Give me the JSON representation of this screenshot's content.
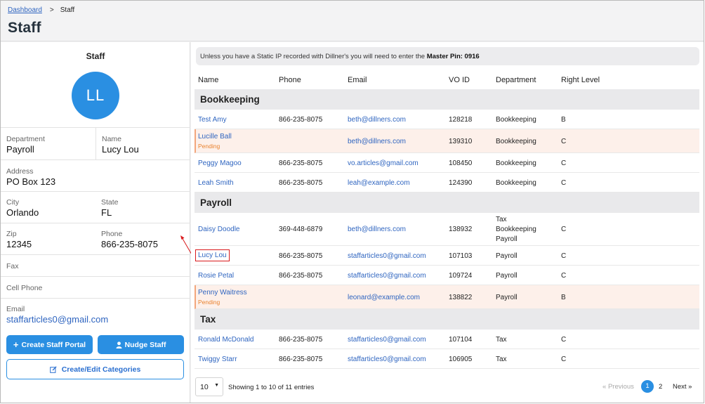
{
  "breadcrumb": {
    "link": "Dashboard",
    "separator": ">",
    "current": "Staff"
  },
  "page_title": "Staff",
  "profile": {
    "title": "Staff",
    "initials": "LL",
    "fields": {
      "department_label": "Department",
      "department": "Payroll",
      "name_label": "Name",
      "name": "Lucy Lou",
      "address_label": "Address",
      "address": "PO Box 123",
      "city_label": "City",
      "city": "Orlando",
      "state_label": "State",
      "state": "FL",
      "zip_label": "Zip",
      "zip": "12345",
      "phone_label": "Phone",
      "phone": "866-235-8075",
      "fax_label": "Fax",
      "cell_label": "Cell Phone",
      "email_label": "Email",
      "email": "staffarticles0@gmail.com"
    },
    "buttons": {
      "create_portal": "Create Staff Portal",
      "nudge": "Nudge Staff",
      "categories": "Create/Edit Categories"
    }
  },
  "notice": {
    "text": "Unless you have a Static IP recorded with Dillner's you will need to enter the ",
    "bold": "Master Pin: 0916"
  },
  "table": {
    "headers": [
      "Name",
      "Phone",
      "Email",
      "VO ID",
      "Department",
      "Right Level"
    ],
    "groups": {
      "bookkeeping": "Bookkeeping",
      "payroll": "Payroll",
      "tax": "Tax"
    },
    "rows": [
      {
        "name": "Test Amy",
        "phone": "866-235-8075",
        "email": "beth@dillners.com",
        "vo_id": "128218",
        "department": "Bookkeeping",
        "level": "B"
      },
      {
        "name": "Lucille Ball",
        "status": "Pending",
        "phone": "",
        "email": "beth@dillners.com",
        "vo_id": "139310",
        "department": "Bookkeeping",
        "level": "C"
      },
      {
        "name": "Peggy Magoo",
        "phone": "866-235-8075",
        "email": "vo.articles@gmail.com",
        "vo_id": "108450",
        "department": "Bookkeeping",
        "level": "C"
      },
      {
        "name": "Leah Smith",
        "phone": "866-235-8075",
        "email": "leah@example.com",
        "vo_id": "124390",
        "department": "Bookkeeping",
        "level": "C"
      },
      {
        "name": "Daisy Doodle",
        "phone": "369-448-6879",
        "email": "beth@dillners.com",
        "vo_id": "138932",
        "department_lines": [
          "Tax",
          "Bookkeeping",
          "Payroll"
        ],
        "level": "C"
      },
      {
        "name": "Lucy Lou",
        "phone": "866-235-8075",
        "email": "staffarticles0@gmail.com",
        "vo_id": "107103",
        "department": "Payroll",
        "level": "C"
      },
      {
        "name": "Rosie Petal",
        "phone": "866-235-8075",
        "email": "staffarticles0@gmail.com",
        "vo_id": "109724",
        "department": "Payroll",
        "level": "C"
      },
      {
        "name": "Penny Waitress",
        "status": "Pending",
        "phone": "",
        "email": "leonard@example.com",
        "vo_id": "138822",
        "department": "Payroll",
        "level": "B"
      },
      {
        "name": "Ronald McDonald",
        "phone": "866-235-8075",
        "email": "staffarticles0@gmail.com",
        "vo_id": "107104",
        "department": "Tax",
        "level": "C"
      },
      {
        "name": "Twiggy Starr",
        "phone": "866-235-8075",
        "email": "staffarticles0@gmail.com",
        "vo_id": "106905",
        "department": "Tax",
        "level": "C"
      }
    ]
  },
  "pagination": {
    "page_size": "10",
    "showing": "Showing 1 to 10 of 11 entries",
    "previous": "Previous",
    "page1": "1",
    "page2": "2",
    "next": "Next"
  },
  "colors": {
    "accent": "#2a8fe2",
    "link": "#2f65c0",
    "pending": "#e9822f",
    "highlight": "#d9191c"
  },
  "icons": {
    "create_portal": "plus-icon",
    "nudge": "user-icon",
    "categories": "edit-icon"
  }
}
